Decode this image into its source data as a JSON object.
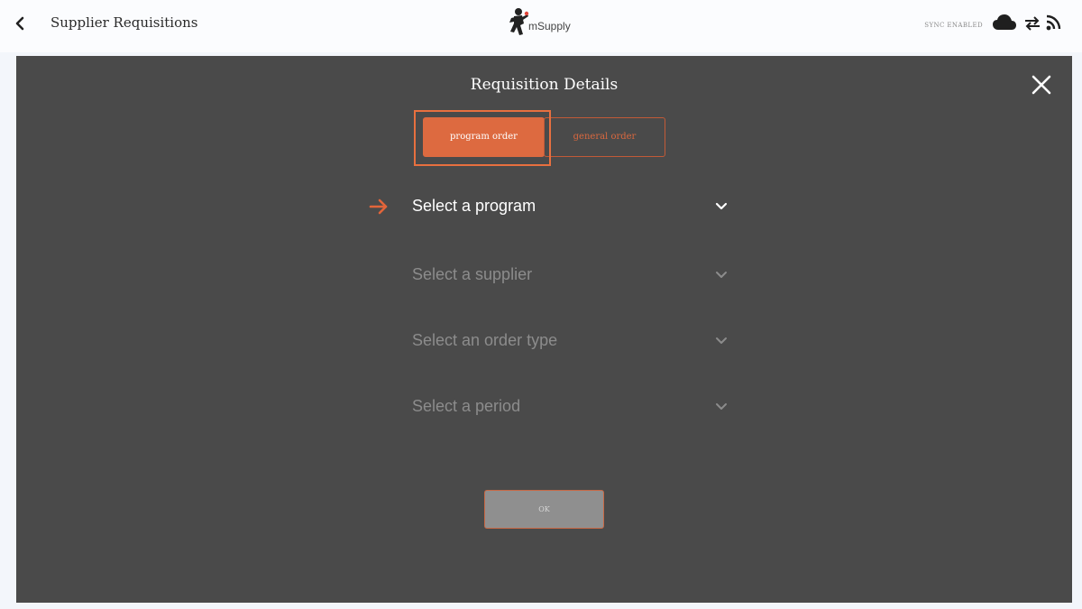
{
  "header": {
    "title": "Supplier Requisitions",
    "brand": "mSupply",
    "sync_status": "SYNC ENABLED",
    "icons": [
      "back-chevron-icon",
      "cloud-icon",
      "sync-arrows-icon",
      "rss-icon"
    ]
  },
  "modal": {
    "title": "Requisition Details",
    "tabs": [
      {
        "label": "program order",
        "selected": true
      },
      {
        "label": "general order",
        "selected": false
      }
    ],
    "fields": [
      {
        "label": "Select a program",
        "active": true
      },
      {
        "label": "Select a supplier",
        "active": false
      },
      {
        "label": "Select an order type",
        "active": false
      },
      {
        "label": "Select a period",
        "active": false
      }
    ],
    "ok_label": "OK"
  },
  "colors": {
    "accent": "#dd6a40",
    "modal_bg": "#4a4a4a",
    "app_bg": "#f3f6fb",
    "inactive_text": "#8c8c8c"
  }
}
